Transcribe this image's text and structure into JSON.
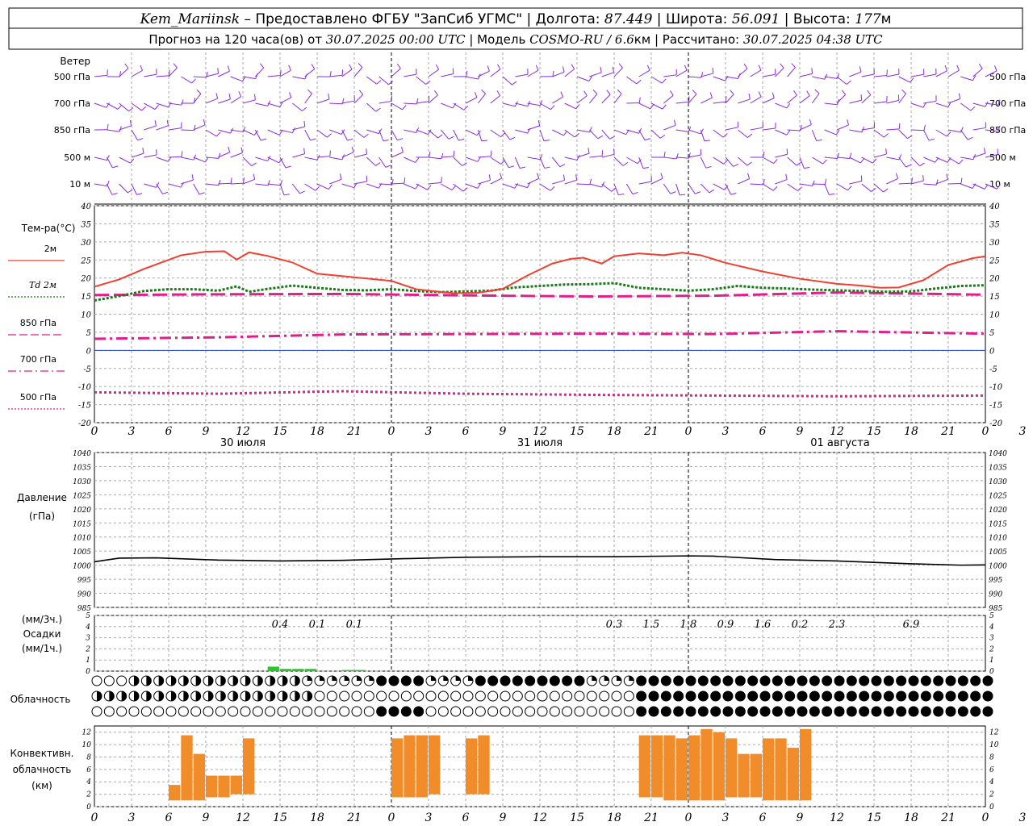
{
  "header": {
    "station": "Kem_Mariinsk",
    "provider": "– Предоставлено ФГБУ \"ЗапСиб УГМС\"",
    "lon_label": "Долгота:",
    "lon": "87.449",
    "lat_label": "Широта:",
    "lat": "56.091",
    "alt_label": "Высота:",
    "alt": "177",
    "alt_unit": "м",
    "forecast_label": "Прогноз на 120 часа(ов) от",
    "forecast_from": "30.07.2025 00:00 UTC",
    "model_label": "| Модель",
    "model": "COSMO-RU / 6.6",
    "model_unit": "км",
    "calc_label": "| Рассчитано:",
    "calc": "30.07.2025 04:38 UTC"
  },
  "x_ticks": [
    "0",
    "3",
    "6",
    "9",
    "12",
    "15",
    "18",
    "21",
    "0",
    "3",
    "6",
    "9",
    "12",
    "15",
    "18",
    "21",
    "0",
    "3",
    "6",
    "9",
    "12",
    "15",
    "18",
    "21",
    "0",
    "3",
    "6"
  ],
  "dates": [
    "30 июля",
    "31 июля",
    "01 августа"
  ],
  "wind": {
    "title": "Ветер",
    "levels": [
      "500 гПа",
      "700 гПа",
      "850 гПа",
      "500 м",
      "10 м"
    ],
    "color": "#8a2be2"
  },
  "temperature": {
    "title": "Тем-ра(°С)",
    "legend": [
      {
        "label": "2м",
        "color": "#f04030",
        "style": "solid"
      },
      {
        "label": "Td  2м",
        "color": "#1a7a1a",
        "style": "dot"
      },
      {
        "label": "850 гПа",
        "color": "#e0208a",
        "style": "dash"
      },
      {
        "label": "700 гПа",
        "color": "#e0208a",
        "style": "dashdot"
      },
      {
        "label": "500 гПа",
        "color": "#e0208a",
        "style": "dot"
      }
    ],
    "y_ticks": [
      "40",
      "35",
      "30",
      "25",
      "20",
      "15",
      "10",
      "5",
      "0",
      "-5",
      "-10",
      "-15",
      "-20"
    ]
  },
  "pressure": {
    "title": "Давление",
    "unit": "(гПа)",
    "y_ticks": [
      "1040",
      "1035",
      "1030",
      "1025",
      "1020",
      "1015",
      "1010",
      "1005",
      "1000",
      "995",
      "990",
      "985"
    ]
  },
  "precip": {
    "title_top": "(мм/3ч.)",
    "title": "Осадки",
    "title_bottom": "(мм/1ч.)",
    "y_ticks": [
      "5",
      "4",
      "3",
      "2",
      "1",
      "0"
    ],
    "labels": [
      {
        "h": 15,
        "text": "0.4"
      },
      {
        "h": 18,
        "text": "0.1"
      },
      {
        "h": 21,
        "text": "0.1"
      },
      {
        "h": 42,
        "text": "0.3"
      },
      {
        "h": 45,
        "text": "1.5"
      },
      {
        "h": 48,
        "text": "1.8"
      },
      {
        "h": 51,
        "text": "0.9"
      },
      {
        "h": 54,
        "text": "1.6"
      },
      {
        "h": 57,
        "text": "0.2"
      },
      {
        "h": 60,
        "text": "2.3"
      },
      {
        "h": 66,
        "text": "6.9"
      }
    ]
  },
  "cloud": {
    "title": "Облачность"
  },
  "convective": {
    "title_lines": [
      "Конвективн.",
      "облачность",
      "(км)"
    ],
    "y_ticks": [
      "12",
      "10",
      "8",
      "6",
      "4",
      "2",
      "0"
    ]
  },
  "chart_data": {
    "type": "line",
    "x_hours_start": 0,
    "x_hours_end": 72,
    "temp_2m": [
      [
        0,
        17.6
      ],
      [
        2,
        19.6
      ],
      [
        4,
        22.5
      ],
      [
        7,
        26.3
      ],
      [
        9,
        27.3
      ],
      [
        10.5,
        27.4
      ],
      [
        11.5,
        25.1
      ],
      [
        12.5,
        27.1
      ],
      [
        14,
        26.1
      ],
      [
        16,
        24.3
      ],
      [
        18,
        21.2
      ],
      [
        21,
        20.2
      ],
      [
        24,
        19.2
      ],
      [
        26,
        16.9
      ],
      [
        29,
        15.8
      ],
      [
        31,
        15.9
      ],
      [
        33,
        17.0
      ],
      [
        35,
        20.7
      ],
      [
        37,
        24.0
      ],
      [
        38.5,
        25.3
      ],
      [
        39.5,
        25.6
      ],
      [
        41,
        24.0
      ],
      [
        42,
        26.0
      ],
      [
        44,
        26.8
      ],
      [
        46,
        26.3
      ],
      [
        47.5,
        27.0
      ],
      [
        49,
        26.3
      ],
      [
        51,
        24.2
      ],
      [
        54,
        21.8
      ],
      [
        57,
        19.8
      ],
      [
        60,
        18.4
      ],
      [
        62,
        17.9
      ],
      [
        63.5,
        17.3
      ],
      [
        65,
        17.4
      ],
      [
        67,
        19.4
      ],
      [
        69,
        23.6
      ],
      [
        71,
        25.5
      ],
      [
        72,
        26.0
      ]
    ],
    "td_2m": [
      [
        0,
        13.8
      ],
      [
        2,
        15.0
      ],
      [
        4,
        16.4
      ],
      [
        6,
        16.9
      ],
      [
        8,
        16.9
      ],
      [
        10,
        16.5
      ],
      [
        11.5,
        17.7
      ],
      [
        12.5,
        16.2
      ],
      [
        14,
        17.0
      ],
      [
        16,
        17.9
      ],
      [
        18,
        17.3
      ],
      [
        20,
        16.7
      ],
      [
        22,
        16.6
      ],
      [
        24,
        16.9
      ],
      [
        26,
        16.4
      ],
      [
        28,
        16.1
      ],
      [
        30,
        16.3
      ],
      [
        32,
        16.5
      ],
      [
        34,
        17.4
      ],
      [
        36,
        17.8
      ],
      [
        38,
        18.2
      ],
      [
        40,
        18.3
      ],
      [
        42,
        18.6
      ],
      [
        44,
        17.3
      ],
      [
        46,
        16.9
      ],
      [
        48,
        16.5
      ],
      [
        50,
        16.9
      ],
      [
        52,
        17.8
      ],
      [
        54,
        17.3
      ],
      [
        56,
        17.1
      ],
      [
        58,
        16.8
      ],
      [
        60,
        16.6
      ],
      [
        62,
        16.4
      ],
      [
        64,
        16.2
      ],
      [
        66,
        16.3
      ],
      [
        68,
        17.1
      ],
      [
        70,
        17.8
      ],
      [
        72,
        18.0
      ]
    ],
    "t850": [
      [
        0,
        15.3
      ],
      [
        10,
        15.5
      ],
      [
        20,
        15.6
      ],
      [
        30,
        15.2
      ],
      [
        40,
        14.9
      ],
      [
        50,
        15.1
      ],
      [
        60,
        16.0
      ],
      [
        72,
        15.4
      ]
    ],
    "t700": [
      [
        0,
        3.2
      ],
      [
        10,
        3.6
      ],
      [
        20,
        4.4
      ],
      [
        30,
        4.5
      ],
      [
        40,
        4.6
      ],
      [
        50,
        4.5
      ],
      [
        60,
        5.3
      ],
      [
        72,
        4.6
      ]
    ],
    "t500": [
      [
        0,
        -11.6
      ],
      [
        10,
        -12.0
      ],
      [
        20,
        -11.3
      ],
      [
        30,
        -12.0
      ],
      [
        40,
        -12.3
      ],
      [
        50,
        -12.5
      ],
      [
        60,
        -12.7
      ],
      [
        72,
        -12.5
      ]
    ],
    "pressure": [
      [
        0,
        1001.2
      ],
      [
        2,
        1002.5
      ],
      [
        5,
        1002.6
      ],
      [
        10,
        1001.8
      ],
      [
        15,
        1001.5
      ],
      [
        20,
        1001.7
      ],
      [
        25,
        1002.3
      ],
      [
        30,
        1002.8
      ],
      [
        36,
        1003.0
      ],
      [
        42,
        1003.0
      ],
      [
        48,
        1003.3
      ],
      [
        50,
        1003.2
      ],
      [
        55,
        1002.0
      ],
      [
        60,
        1001.5
      ],
      [
        66,
        1000.5
      ],
      [
        70,
        1000.0
      ],
      [
        72,
        1000.1
      ]
    ],
    "precip_hourly": [
      [
        14,
        0.4
      ],
      [
        15,
        0.2
      ],
      [
        16,
        0.2
      ],
      [
        17,
        0.2
      ],
      [
        20,
        0.1
      ],
      [
        21,
        0.1
      ]
    ],
    "convective_bars": [
      [
        6,
        1.0,
        3.5
      ],
      [
        7,
        1.0,
        11.5
      ],
      [
        8,
        1.0,
        8.5
      ],
      [
        9,
        1.5,
        5.0
      ],
      [
        10,
        1.5,
        5.0
      ],
      [
        11,
        2.0,
        5.0
      ],
      [
        12,
        2.0,
        11.0
      ],
      [
        24,
        1.5,
        11.0
      ],
      [
        25,
        1.5,
        11.5
      ],
      [
        26,
        1.5,
        11.5
      ],
      [
        27,
        2.0,
        11.5
      ],
      [
        30,
        2.0,
        11.0
      ],
      [
        31,
        2.0,
        11.5
      ],
      [
        44,
        1.5,
        11.5
      ],
      [
        45,
        1.5,
        11.5
      ],
      [
        46,
        1.0,
        11.5
      ],
      [
        47,
        1.0,
        11.0
      ],
      [
        48,
        1.0,
        11.5
      ],
      [
        49,
        1.0,
        12.5
      ],
      [
        50,
        1.0,
        12.0
      ],
      [
        51,
        1.5,
        11.0
      ],
      [
        52,
        1.5,
        8.5
      ],
      [
        53,
        1.5,
        8.5
      ],
      [
        54,
        1.0,
        11.0
      ],
      [
        55,
        1.0,
        11.0
      ],
      [
        56,
        1.0,
        9.5
      ],
      [
        57,
        1.0,
        12.5
      ]
    ]
  }
}
